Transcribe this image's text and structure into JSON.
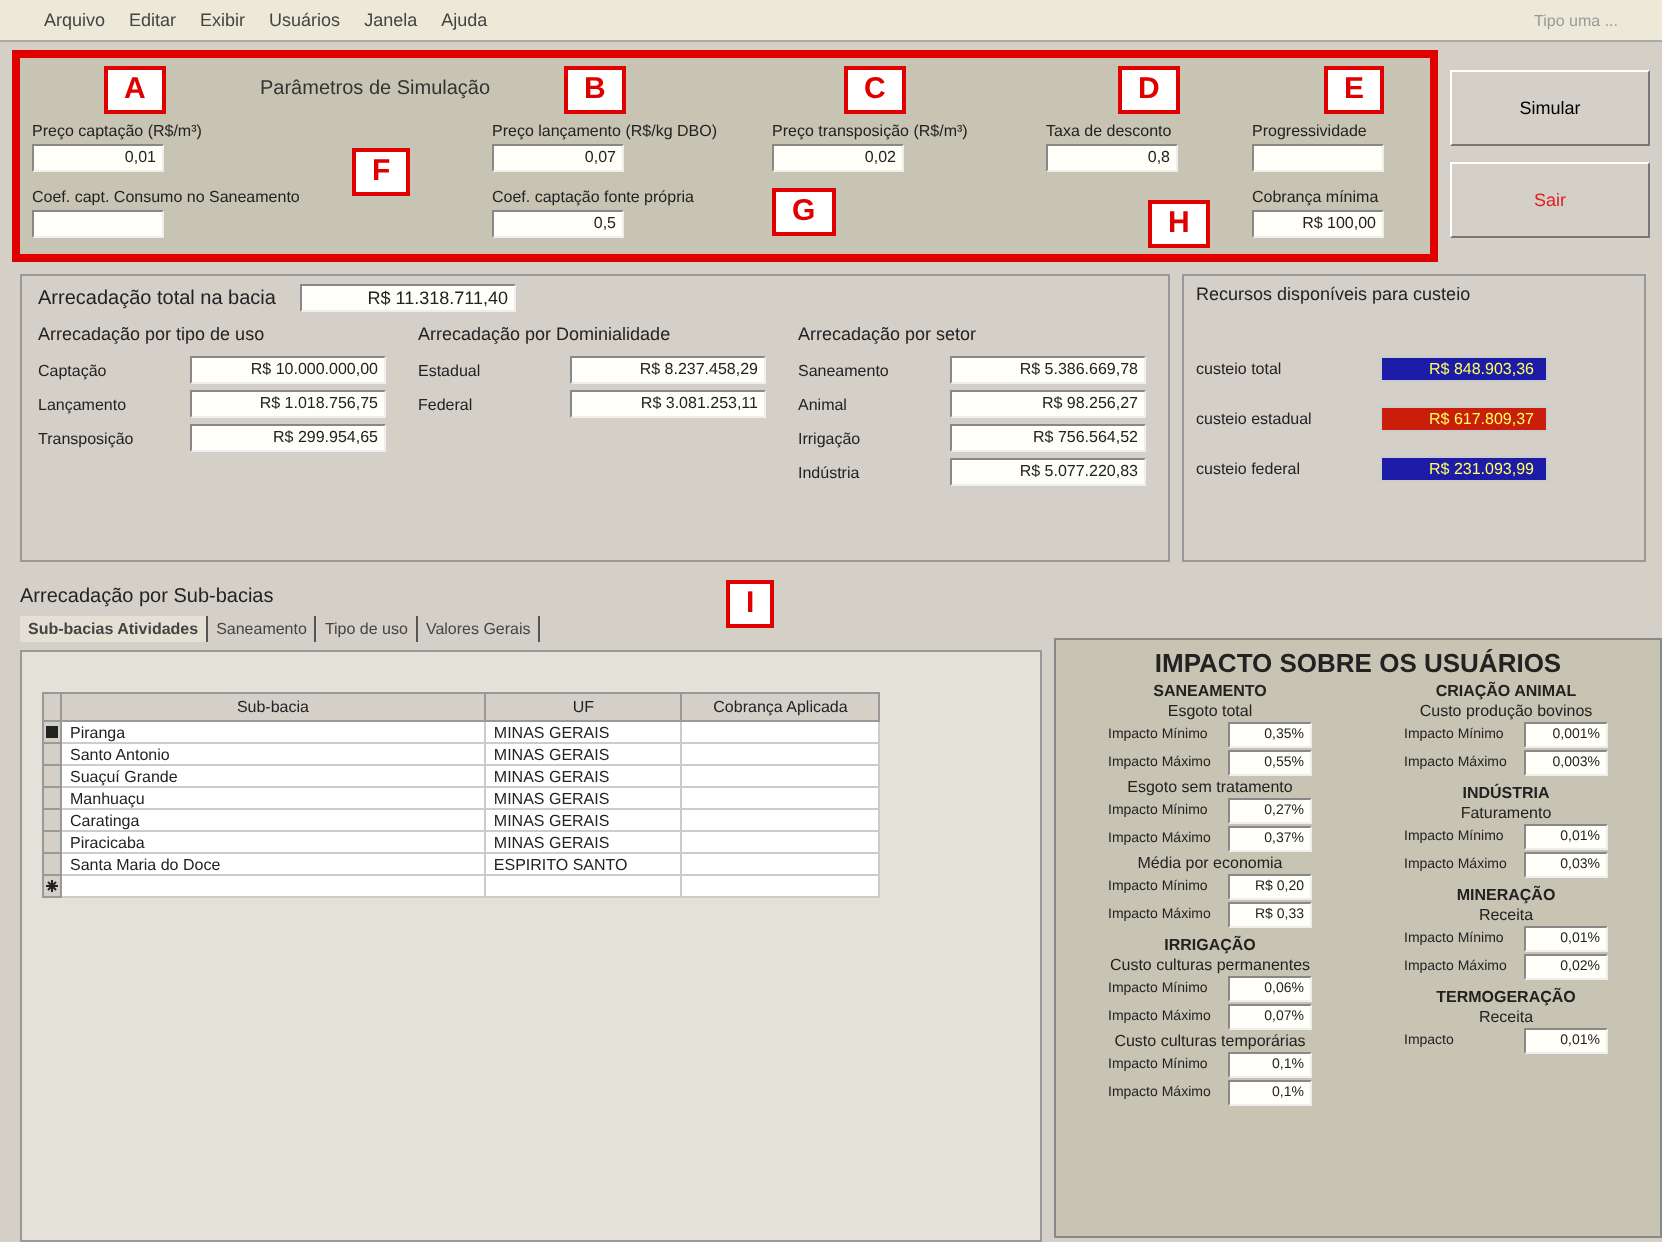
{
  "menu": [
    "Arquivo",
    "Editar",
    "Exibir",
    "Usuários",
    "Janela",
    "Ajuda"
  ],
  "window_caption": "Tipo uma ...",
  "parameters": {
    "title": "Parâmetros de Simulação",
    "fields": [
      {
        "marker": "A",
        "label": "Preço captação (R$/m³)",
        "value": "0,01"
      },
      {
        "marker": "B",
        "label": "Preço lançamento (R$/kg DBO)",
        "value": "0,07"
      },
      {
        "marker": "C",
        "label": "Preço transposição (R$/m³)",
        "value": "0,02"
      },
      {
        "marker": "D",
        "label": "Taxa de desconto",
        "value": "0,8"
      },
      {
        "marker": "E",
        "label": "Progressividade"
      },
      {
        "marker": "F",
        "label": "Coef. capt. Consumo no Saneamento"
      },
      {
        "marker": "G",
        "label": "Coef. captação fonte própria",
        "value": "0,5"
      },
      {
        "marker": "H",
        "label": "Cobrança mínima",
        "value": "R$ 100,00"
      }
    ]
  },
  "buttons": [
    {
      "label": "Simular",
      "kind": "normal"
    },
    {
      "label": "Sair",
      "kind": "danger"
    }
  ],
  "total": {
    "label": "Arrecadação total na bacia",
    "value": "R$ 11.318.711,40"
  },
  "groups": [
    {
      "title": "Arrecadação por tipo de uso",
      "rows": [
        {
          "label": "Captação",
          "value": "R$ 10.000.000,00"
        },
        {
          "label": "Lançamento",
          "value": "R$ 1.018.756,75"
        },
        {
          "label": "Transposição",
          "value": "R$ 299.954,65"
        }
      ]
    },
    {
      "title": "Arrecadação por Dominialidade",
      "rows": [
        {
          "label": "Estadual",
          "value": "R$ 8.237.458,29"
        },
        {
          "label": "Federal",
          "value": "R$ 3.081.253,11"
        }
      ]
    },
    {
      "title": "Arrecadação por setor",
      "rows": [
        {
          "label": "Saneamento",
          "value": "R$ 5.386.669,78"
        },
        {
          "label": "Animal",
          "value": "R$ 98.256,27"
        },
        {
          "label": "Irrigação",
          "value": "R$ 756.564,52"
        },
        {
          "label": "Indústria",
          "value": "R$ 5.077.220,83"
        }
      ]
    }
  ],
  "resources": {
    "title": "Recursos disponíveis para custeio",
    "items": [
      {
        "label": "custeio total",
        "value": "R$ 848.903,36",
        "color": "#1c1ca8"
      },
      {
        "label": "custeio estadual",
        "value": "R$ 617.809,37",
        "color": "#c81e0a"
      },
      {
        "label": "custeio federal",
        "value": "R$ 231.093,99",
        "color": "#1c1ca8"
      }
    ]
  },
  "subbasins": {
    "title": "Arrecadação por Sub-bacias",
    "tabs": [
      {
        "label": "Sub-bacias Atividades",
        "selected": true
      },
      {
        "label": "Saneamento",
        "selected": false
      },
      {
        "label": "Tipo de uso",
        "selected": false
      },
      {
        "label": "Valores Gerais",
        "selected": false
      }
    ],
    "table": {
      "columns": [
        "Sub-bacia",
        "UF",
        "Cobrança Aplicada"
      ],
      "marker": "I",
      "rows": [
        {
          "cells": [
            "Piranga",
            "MINAS GERAIS",
            ""
          ],
          "selected": true
        },
        {
          "cells": [
            "Santo Antonio",
            "MINAS GERAIS",
            ""
          ],
          "selected": false
        },
        {
          "cells": [
            "Suaçuí Grande",
            "MINAS GERAIS",
            ""
          ],
          "selected": false
        },
        {
          "cells": [
            "Manhuaçu",
            "MINAS GERAIS",
            ""
          ],
          "selected": false
        },
        {
          "cells": [
            "Caratinga",
            "MINAS GERAIS",
            ""
          ],
          "selected": false
        },
        {
          "cells": [
            "Piracicaba",
            "MINAS GERAIS",
            ""
          ],
          "selected": false
        },
        {
          "cells": [
            "Santa Maria do Doce",
            "ESPIRITO SANTO",
            ""
          ],
          "selected": false
        }
      ]
    }
  },
  "impact": {
    "title": "IMPACTO SOBRE OS USUÁRIOS",
    "columns": [
      [
        {
          "title": "SANEAMENTO",
          "groups": [
            {
              "title": "Esgoto total",
              "rows": [
                {
                  "label": "Impacto Mínimo",
                  "value": "0,35%"
                },
                {
                  "label": "Impacto Máximo",
                  "value": "0,55%"
                }
              ]
            },
            {
              "title": "Esgoto sem tratamento",
              "rows": [
                {
                  "label": "Impacto Mínimo",
                  "value": "0,27%"
                },
                {
                  "label": "Impacto Máximo",
                  "value": "0,37%"
                }
              ]
            },
            {
              "title": "Média por economia",
              "rows": [
                {
                  "label": "Impacto Mínimo",
                  "value": "R$ 0,20"
                },
                {
                  "label": "Impacto Máximo",
                  "value": "R$ 0,33"
                }
              ]
            }
          ]
        },
        {
          "title": "IRRIGAÇÃO",
          "groups": [
            {
              "title": "Custo culturas permanentes",
              "rows": [
                {
                  "label": "Impacto Mínimo",
                  "value": "0,06%"
                },
                {
                  "label": "Impacto Máximo",
                  "value": "0,07%"
                }
              ]
            },
            {
              "title": "Custo culturas temporárias",
              "rows": [
                {
                  "label": "Impacto Mínimo",
                  "value": "0,1%"
                },
                {
                  "label": "Impacto Máximo",
                  "value": "0,1%"
                }
              ]
            }
          ]
        }
      ],
      [
        {
          "title": "CRIAÇÃO ANIMAL",
          "groups": [
            {
              "title": "Custo produção bovinos",
              "rows": [
                {
                  "label": "Impacto Mínimo",
                  "value": "0,001%"
                },
                {
                  "label": "Impacto Máximo",
                  "value": "0,003%"
                }
              ]
            }
          ]
        },
        {
          "title": "INDÚSTRIA",
          "groups": [
            {
              "title": "Faturamento",
              "rows": [
                {
                  "label": "Impacto Mínimo",
                  "value": "0,01%"
                },
                {
                  "label": "Impacto Máximo",
                  "value": "0,03%"
                }
              ]
            }
          ]
        },
        {
          "title": "MINERAÇÃO",
          "groups": [
            {
              "title": "Receita",
              "rows": [
                {
                  "label": "Impacto Mínimo",
                  "value": "0,01%"
                },
                {
                  "label": "Impacto Máximo",
                  "value": "0,02%"
                }
              ]
            }
          ]
        },
        {
          "title": "TERMOGERAÇÃO",
          "groups": [
            {
              "title": "Receita",
              "rows": [
                {
                  "label": "Impacto",
                  "value": "0,01%"
                }
              ]
            }
          ]
        }
      ]
    ]
  }
}
